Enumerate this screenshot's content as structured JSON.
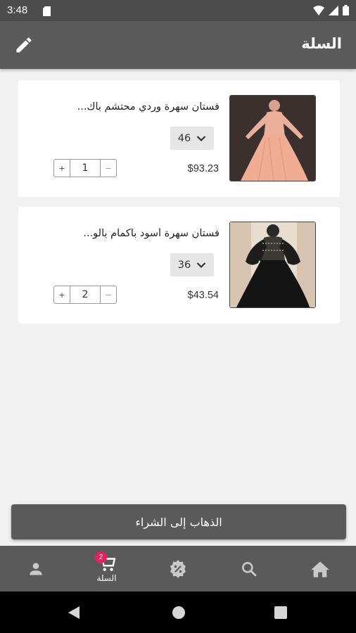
{
  "status_bar": {
    "time": "3:48"
  },
  "app_bar": {
    "title": "السلة"
  },
  "cart": {
    "items": [
      {
        "title": "فستان سهرة وردي محتشم بأك...",
        "size": "46",
        "price": "$93.23",
        "quantity": "1"
      },
      {
        "title": "فستان سهرة أسود بأكمام بالو...",
        "size": "36",
        "price": "$43.54",
        "quantity": "2"
      }
    ],
    "stepper": {
      "plus": "+",
      "minus": "−"
    }
  },
  "checkout": {
    "label": "الذهاب إلى الشراء"
  },
  "bottom_nav": {
    "cart_label": "السلة",
    "cart_badge": "2",
    "items": [
      "profile-icon",
      "cart-icon",
      "discount-icon",
      "search-icon",
      "home-icon"
    ]
  },
  "colors": {
    "bar": "#5a5a5a",
    "status": "#4c4c4c",
    "badge": "#e91e63",
    "background": "#f1f1f1"
  }
}
